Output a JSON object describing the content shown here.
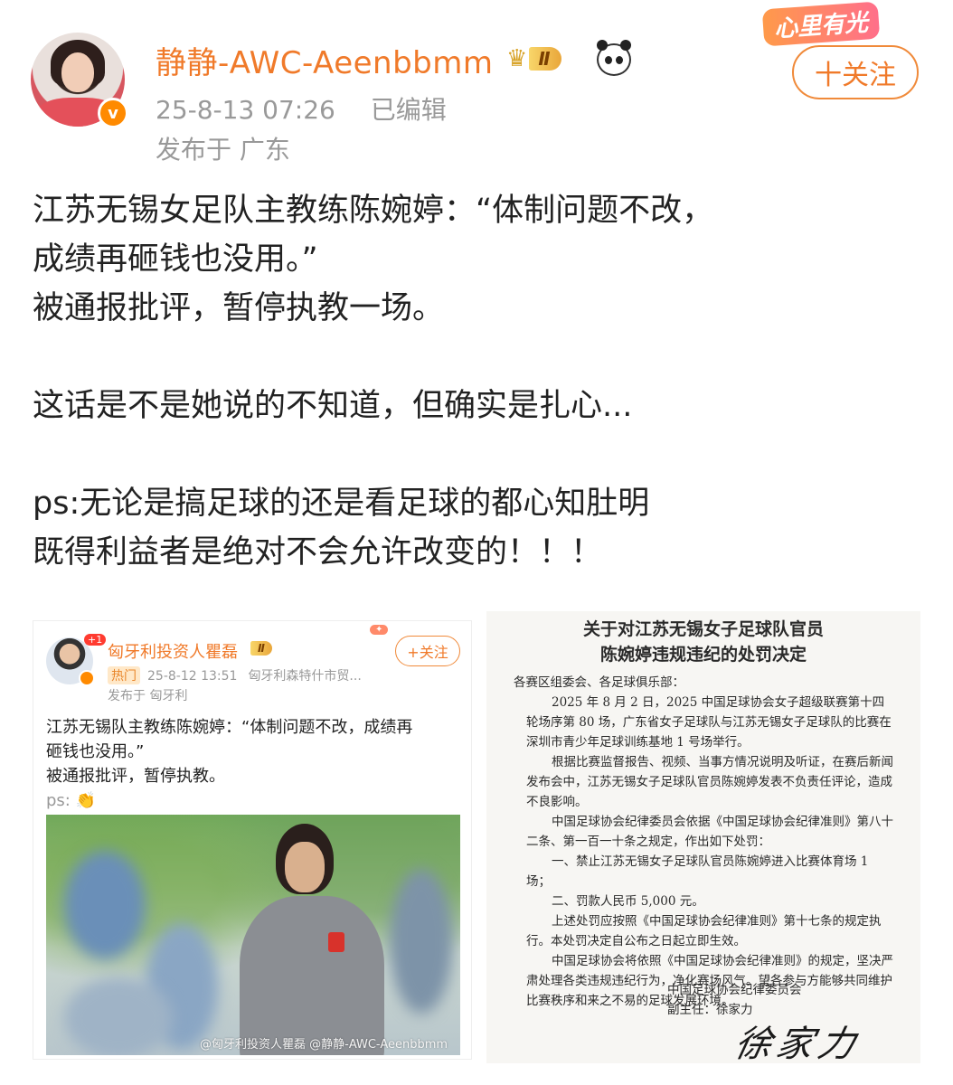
{
  "header": {
    "username": "静静-AWC-Aeenbbmm",
    "rank_badge_level": "Ⅱ",
    "timestamp": "25-8-13 07:26",
    "edited_label": "已编辑",
    "location": "发布于 广东",
    "follow_label": "十关注",
    "deco_label": "心里有光"
  },
  "post": {
    "lines": [
      "江苏无锡女足队主教练陈婉婷：“体制问题不改，",
      "成绩再砸钱也没用。”",
      "被通报批评，暂停执教一场。",
      "",
      "这话是不是她说的不知道，但确实是扎心...",
      "",
      "ps:无论是搞足球的还是看足球的都心知肚明",
      "既得利益者是绝对不会允许改变的！！！"
    ]
  },
  "image1": {
    "notification_count": "+1",
    "name": "匈牙利投资人瞿磊",
    "rank": "Ⅱ",
    "follow_label": "+关注",
    "hot_tag": "热门",
    "timestamp": "25-8-12 13:51",
    "source": "匈牙利森特什市贸...",
    "location": "发布于 匈牙利",
    "text_lines": [
      "江苏无锡队主教练陈婉婷：“体制问题不改，成绩再",
      "砸钱也没用。”",
      "被通报批评，暂停执教。",
      "ps: 👏"
    ],
    "watermark": "@匈牙利投资人瞿磊 @静静-AWC-Aeenbbmm"
  },
  "image2": {
    "title_lines": [
      "关于对江苏无锡女子足球队官员",
      "陈婉婷违规违纪的处罚决定"
    ],
    "salutation": "各赛区组委会、各足球俱乐部：",
    "paragraphs": [
      "2025 年 8 月 2 日，2025 中国足球协会女子超级联赛第十四轮场序第 80 场，广东省女子足球队与江苏无锡女子足球队的比赛在深圳市青少年足球训练基地 1 号场举行。",
      "根据比赛监督报告、视频、当事方情况说明及听证，在赛后新闻发布会中，江苏无锡女子足球队官员陈婉婷发表不负责任评论，造成不良影响。",
      "中国足球协会纪律委员会依据《中国足球协会纪律准则》第八十二条、第一百一十条之规定，作出如下处罚：",
      "一、禁止江苏无锡女子足球队官员陈婉婷进入比赛体育场 1 场；",
      "二、罚款人民币 5,000 元。",
      "上述处罚应按照《中国足球协会纪律准则》第十七条的规定执行。本处罚决定自公布之日起立即生效。",
      "中国足球协会将依照《中国足球协会纪律准则》的规定，坚决严肃处理各类违规违纪行为，净化赛场风气。望各参与方能够共同维护比赛秩序和来之不易的足球发展环境。"
    ],
    "signatory_org": "中国足球协会纪律委员会",
    "signatory_title": "副主任：徐家力",
    "signature_script": "徐家力"
  },
  "colors": {
    "accent": "#f07a2a",
    "meta_gray": "#999999",
    "text": "#222222"
  }
}
